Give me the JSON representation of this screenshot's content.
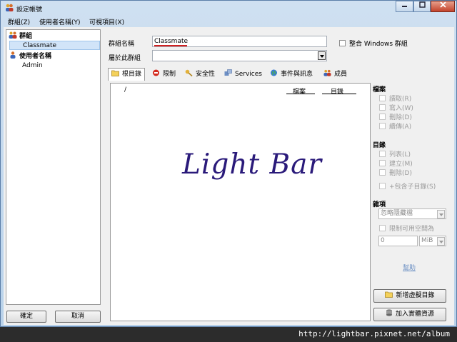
{
  "window": {
    "title": "設定帳號"
  },
  "menu": [
    "群組(Z)",
    "使用者名稱(Y)",
    "可視項目(X)"
  ],
  "tree": {
    "groups_label": "群組",
    "group_items": [
      "Classmate"
    ],
    "users_label": "使用者名稱",
    "user_items": [
      "Admin"
    ]
  },
  "buttons": {
    "ok": "確定",
    "cancel": "取消",
    "add_virtual_dir": "新增虛擬目錄",
    "add_physical": "加入實體資源"
  },
  "form": {
    "group_name_label": "群組名稱",
    "group_name_value": "Classmate",
    "member_of_label": "屬於此群組",
    "member_of_value": "",
    "integrate_windows_label": "整合 Windows 群組"
  },
  "tabs": [
    {
      "label": "根目錄",
      "icon": "folder-icon",
      "active": true
    },
    {
      "label": "限制",
      "icon": "stop-icon",
      "active": false
    },
    {
      "label": "安全性",
      "icon": "key-icon",
      "active": false
    },
    {
      "label": "Services",
      "icon": "services-icon",
      "active": false
    },
    {
      "label": "事件與訊息",
      "icon": "globe-icon",
      "active": false
    },
    {
      "label": "成員",
      "icon": "members-icon",
      "active": false
    }
  ],
  "directory_list": {
    "root_path": "/",
    "col_files": "檔案",
    "col_dirs": "目錄"
  },
  "watermark": "Light Bar",
  "permissions": {
    "files_title": "檔案",
    "files": [
      "讀取(R)",
      "寫入(W)",
      "刪除(D)",
      "續傳(A)"
    ],
    "dirs_title": "目錄",
    "dirs": [
      "列表(L)",
      "建立(M)",
      "刪除(D)"
    ],
    "include_subdirs": "+包含子目錄(S)",
    "misc_title": "雜項",
    "hidden_select": "忽略隱藏檔",
    "limit_space": "限制可用空間為",
    "space_value": "0",
    "space_unit": "MiB",
    "help": "幫助"
  },
  "footer_url": "http://lightbar.pixnet.net/album",
  "colors": {
    "accent_underline": "#d22020",
    "watermark": "#2a1a7a",
    "selection": "#d1e4f8"
  }
}
